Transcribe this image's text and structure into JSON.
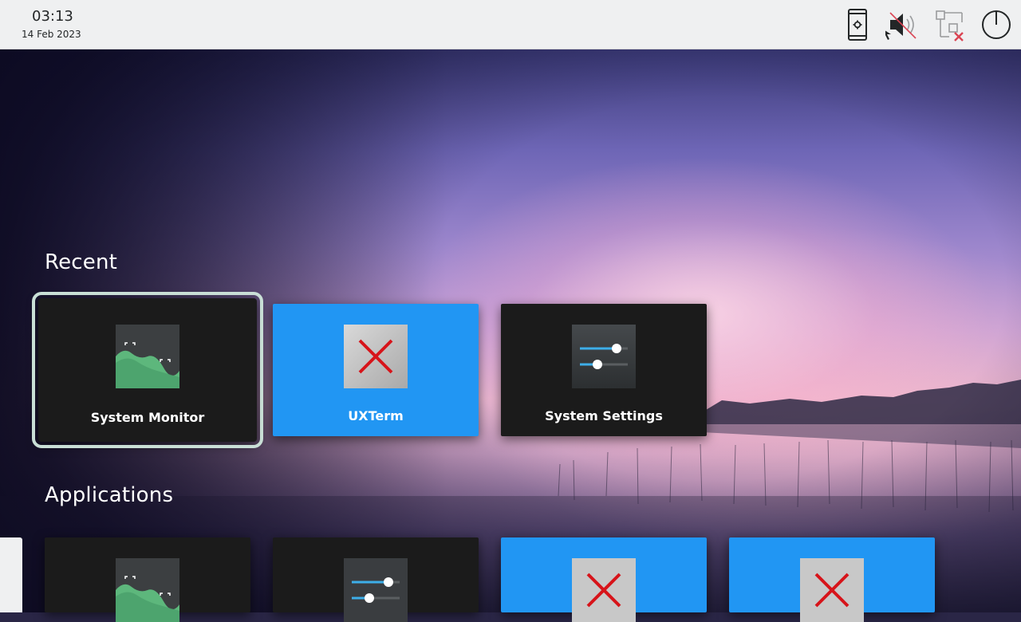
{
  "clock": {
    "time": "03:13",
    "date": "14 Feb 2023"
  },
  "tray": {
    "icons": [
      "phone-settings-icon",
      "speaker-muted-icon",
      "network-disconnected-icon",
      "power-icon"
    ]
  },
  "colors": {
    "accent": "#2196f3",
    "tile_dark": "#1b1b1b",
    "selection": "#c9dfd6",
    "panel": "#eff0f1"
  },
  "recent": {
    "title": "Recent",
    "items": [
      {
        "label": "System Monitor",
        "icon": "system-monitor-icon",
        "style": "dark",
        "selected": true
      },
      {
        "label": "UXTerm",
        "icon": "missing-app-icon",
        "style": "blue",
        "selected": false
      },
      {
        "label": "System Settings",
        "icon": "system-settings-icon",
        "style": "dark",
        "selected": false
      }
    ]
  },
  "applications": {
    "title": "Applications",
    "items": [
      {
        "icon": "system-monitor-icon",
        "style": "dark"
      },
      {
        "icon": "system-settings-icon",
        "style": "dark"
      },
      {
        "icon": "missing-app-icon",
        "style": "blue"
      },
      {
        "icon": "missing-app-icon",
        "style": "blue"
      }
    ]
  }
}
